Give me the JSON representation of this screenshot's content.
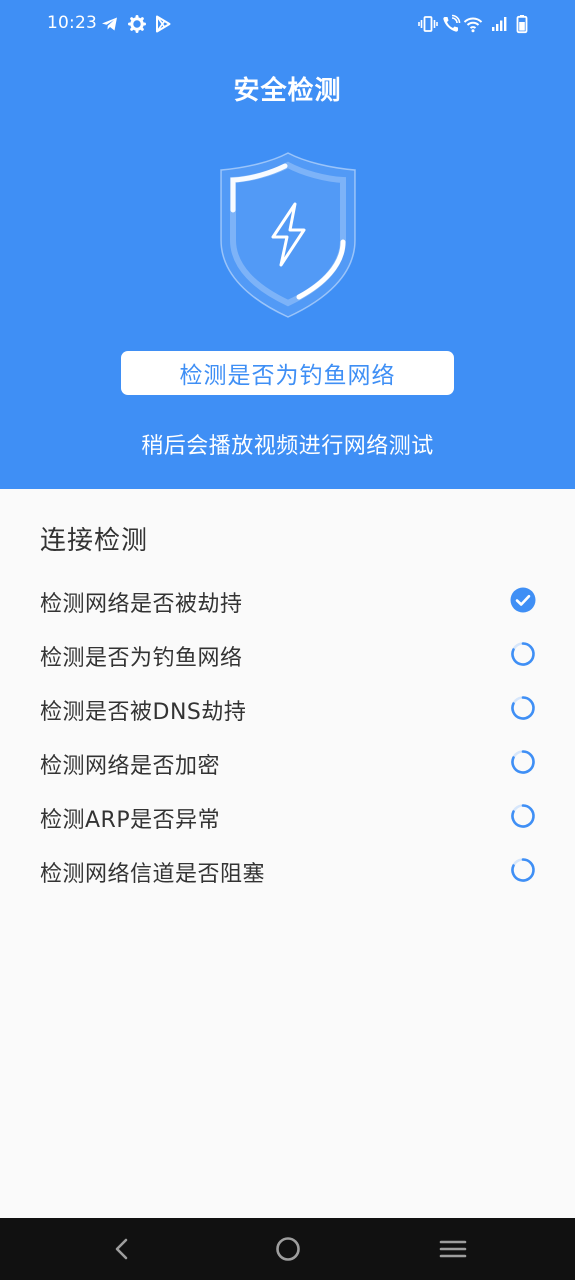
{
  "status_bar": {
    "time": "10:23"
  },
  "header": {
    "title": "安全检测",
    "current_check": "检测是否为钓鱼网络",
    "hint": "稍后会播放视频进行网络测试"
  },
  "colors": {
    "primary": "#3f8ff5",
    "background": "#fafafa",
    "text": "#333333",
    "nav_bar": "#111111"
  },
  "section": {
    "title": "连接检测"
  },
  "checks": [
    {
      "label": "检测网络是否被劫持",
      "status": "done",
      "icon": "check-circle-icon"
    },
    {
      "label": "检测是否为钓鱼网络",
      "status": "loading",
      "icon": "spinner-icon"
    },
    {
      "label": "检测是否被DNS劫持",
      "status": "loading",
      "icon": "spinner-icon"
    },
    {
      "label": "检测网络是否加密",
      "status": "loading",
      "icon": "spinner-icon"
    },
    {
      "label": "检测ARP是否异常",
      "status": "loading",
      "icon": "spinner-icon"
    },
    {
      "label": "检测网络信道是否阻塞",
      "status": "loading",
      "icon": "spinner-icon"
    }
  ]
}
